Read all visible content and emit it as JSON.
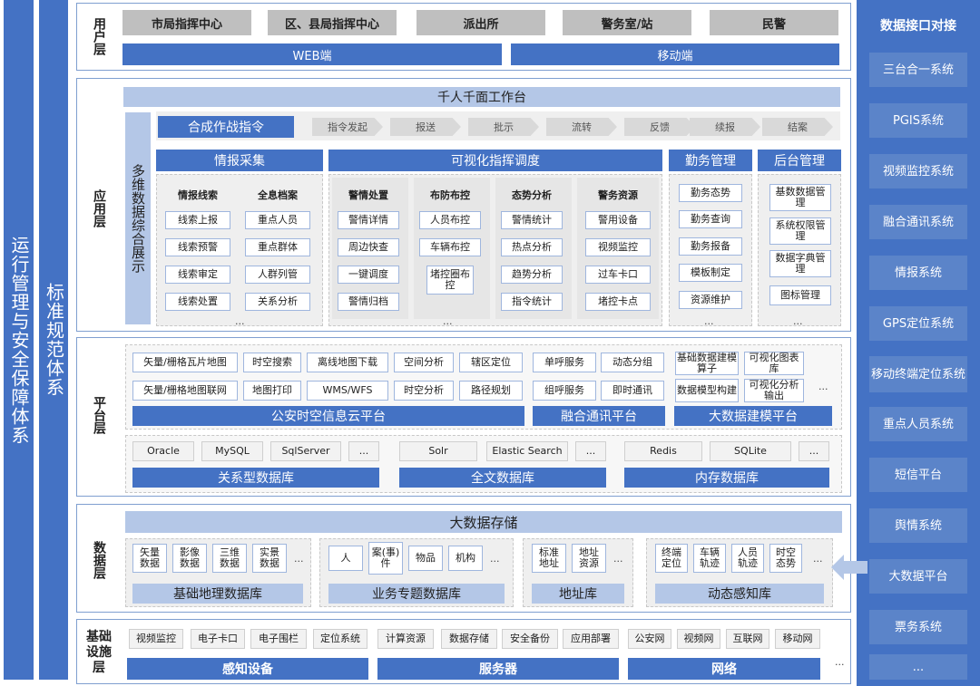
{
  "left_bar_1": "运行管理与安全保障体系",
  "left_bar_2": "标准规范体系",
  "user_layer": {
    "title": "用户层",
    "roles": [
      "市局指挥中心",
      "区、县局指挥中心",
      "派出所",
      "警务室/站",
      "民警"
    ],
    "web": "WEB端",
    "mobile": "移动端"
  },
  "app_layer": {
    "title": "应用层",
    "workbench": "千人千面工作台",
    "side_label": "多维数据综合展示",
    "command": "合成作战指令",
    "flow": [
      "指令发起",
      "报送",
      "批示",
      "流转",
      "反馈",
      "续报",
      "结案"
    ],
    "modules": {
      "intel": {
        "title": "情报采集",
        "cols": [
          {
            "header": "情报线索",
            "items": [
              "线索上报",
              "线索预警",
              "线索审定",
              "线索处置"
            ]
          },
          {
            "header": "全息档案",
            "items": [
              "重点人员",
              "重点群体",
              "人群列管",
              "关系分析"
            ]
          }
        ]
      },
      "visual": {
        "title": "可视化指挥调度",
        "cols": [
          {
            "header": "警情处置",
            "items": [
              "警情详情",
              "周边快查",
              "一键调度",
              "警情归档"
            ]
          },
          {
            "header": "布防布控",
            "items": [
              "人员布控",
              "车辆布控",
              "堵控圈布控"
            ]
          },
          {
            "header": "态势分析",
            "items": [
              "警情统计",
              "热点分析",
              "趋势分析",
              "指令统计"
            ]
          },
          {
            "header": "警务资源",
            "items": [
              "警用设备",
              "视频监控",
              "过车卡口",
              "堵控卡点"
            ]
          }
        ]
      },
      "duty": {
        "title": "勤务管理",
        "items": [
          "勤务态势",
          "勤务查询",
          "勤务报备",
          "模板制定",
          "资源维护"
        ]
      },
      "backend": {
        "title": "后台管理",
        "items": [
          "基数数据管理",
          "系统权限管理",
          "数据字典管理",
          "图标管理"
        ]
      }
    },
    "more": "..."
  },
  "platform_layer": {
    "title": "平台层",
    "services_row1": [
      "矢量/栅格瓦片地图",
      "时空搜索",
      "离线地图下载",
      "空间分析",
      "辖区定位",
      "单呼服务",
      "动态分组",
      "基础数据建模算子",
      "可视化图表库"
    ],
    "services_row2": [
      "矢量/栅格地图联网",
      "地图打印",
      "WMS/WFS",
      "时空分析",
      "路径规划",
      "组呼服务",
      "即时通讯",
      "数据模型构建",
      "可视化分析输出"
    ],
    "platforms": [
      "公安时空信息云平台",
      "融合通讯平台",
      "大数据建模平台"
    ],
    "dbs": [
      {
        "items": [
          "Oracle",
          "MySQL",
          "SqlServer",
          "..."
        ],
        "name": "关系型数据库"
      },
      {
        "items": [
          "Solr",
          "Elastic Search",
          "..."
        ],
        "name": "全文数据库"
      },
      {
        "items": [
          "Redis",
          "SQLite",
          "..."
        ],
        "name": "内存数据库"
      }
    ],
    "more": "..."
  },
  "data_layer": {
    "title": "数据层",
    "storage": "大数据存储",
    "groups": [
      {
        "items": [
          "矢量数据",
          "影像数据",
          "三维数据",
          "实景数据"
        ],
        "name": "基础地理数据库"
      },
      {
        "items": [
          "人",
          "案(事)件",
          "物品",
          "机构"
        ],
        "name": "业务专题数据库"
      },
      {
        "items": [
          "标准地址",
          "地址资源"
        ],
        "name": "地址库"
      },
      {
        "items": [
          "终端定位",
          "车辆轨迹",
          "人员轨迹",
          "时空态势"
        ],
        "name": "动态感知库"
      }
    ],
    "more": "..."
  },
  "infra_layer": {
    "title": "基础设施层",
    "groups": [
      {
        "items": [
          "视频监控",
          "电子卡口",
          "电子围栏",
          "定位系统"
        ],
        "name": "感知设备"
      },
      {
        "items": [
          "计算资源",
          "数据存储",
          "安全备份",
          "应用部署"
        ],
        "name": "服务器"
      },
      {
        "items": [
          "公安网",
          "视频网",
          "互联网",
          "移动网"
        ],
        "name": "网络"
      }
    ],
    "more": "..."
  },
  "right_panel": {
    "title": "数据接口对接",
    "items": [
      "三台合一系统",
      "PGIS系统",
      "视频监控系统",
      "融合通讯系统",
      "情报系统",
      "GPS定位系统",
      "移动终端定位系统",
      "重点人员系统",
      "短信平台",
      "舆情系统",
      "大数据平台",
      "票务系统",
      "..."
    ]
  },
  "colors": {
    "primary": "#4472c4",
    "light": "#b4c7e7",
    "gray": "#bfbfbf"
  }
}
